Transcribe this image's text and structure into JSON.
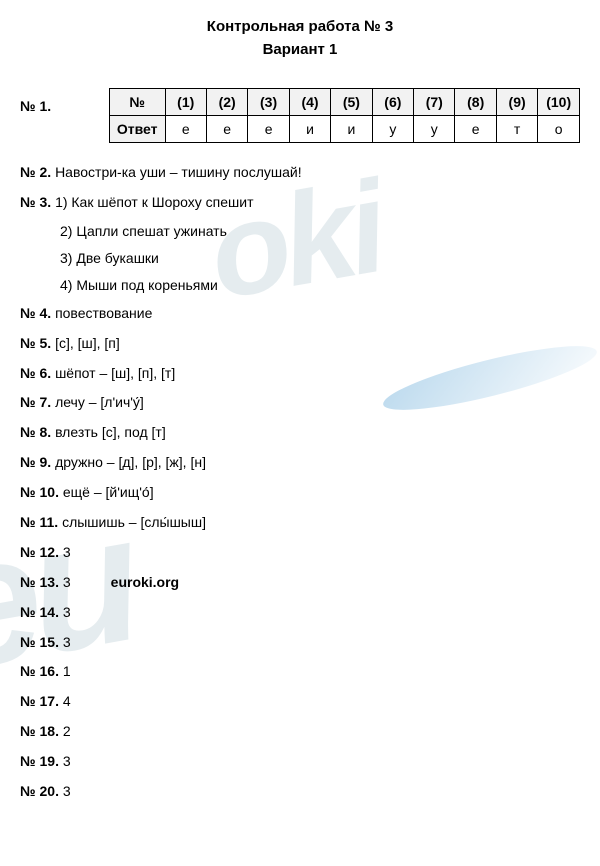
{
  "header": {
    "title": "Контрольная работа № 3",
    "variant": "Вариант 1"
  },
  "q1": {
    "label": "№ 1.",
    "header_row_label": "№",
    "headers": [
      "(1)",
      "(2)",
      "(3)",
      "(4)",
      "(5)",
      "(6)",
      "(7)",
      "(8)",
      "(9)",
      "(10)"
    ],
    "answer_row_label": "Ответ",
    "answers": [
      "е",
      "е",
      "е",
      "и",
      "и",
      "у",
      "у",
      "е",
      "т",
      "о"
    ]
  },
  "q2": {
    "label": "№ 2.",
    "text": "Навостри-ка уши – тишину послушай!"
  },
  "q3": {
    "label": "№ 3.",
    "items": [
      "1) Как шёпот к Шороху спешит",
      "2) Цапли спешат ужинать",
      "3) Две букашки",
      "4) Мыши под кореньями"
    ]
  },
  "q4": {
    "label": "№ 4.",
    "text": "повествование"
  },
  "q5": {
    "label": "№ 5.",
    "text": "[с], [ш], [п]"
  },
  "q6": {
    "label": "№ 6.",
    "text": "шёпот – [ш], [п], [т]"
  },
  "q7": {
    "label": "№ 7.",
    "text": "лечу – [л'ич'у́]"
  },
  "q8": {
    "label": "№ 8.",
    "text": "влезть [с], под [т]"
  },
  "q9": {
    "label": "№ 9.",
    "text": "дружно – [д], [р], [ж], [н]"
  },
  "q10": {
    "label": "№ 10.",
    "text": "ещё – [й'ищ'о́]"
  },
  "q11": {
    "label": "№ 11.",
    "text": "слышишь – [слы́шыш]"
  },
  "q12": {
    "label": "№ 12.",
    "text": "3"
  },
  "q13": {
    "label": "№ 13.",
    "text": "3",
    "tag": "euroki.org"
  },
  "q14": {
    "label": "№ 14.",
    "text": "3"
  },
  "q15": {
    "label": "№ 15.",
    "text": "3"
  },
  "q16": {
    "label": "№ 16.",
    "text": "1"
  },
  "q17": {
    "label": "№ 17.",
    "text": "4"
  },
  "q18": {
    "label": "№ 18.",
    "text": "2"
  },
  "q19": {
    "label": "№ 19.",
    "text": "3"
  },
  "q20": {
    "label": "№ 20.",
    "text": "3"
  }
}
